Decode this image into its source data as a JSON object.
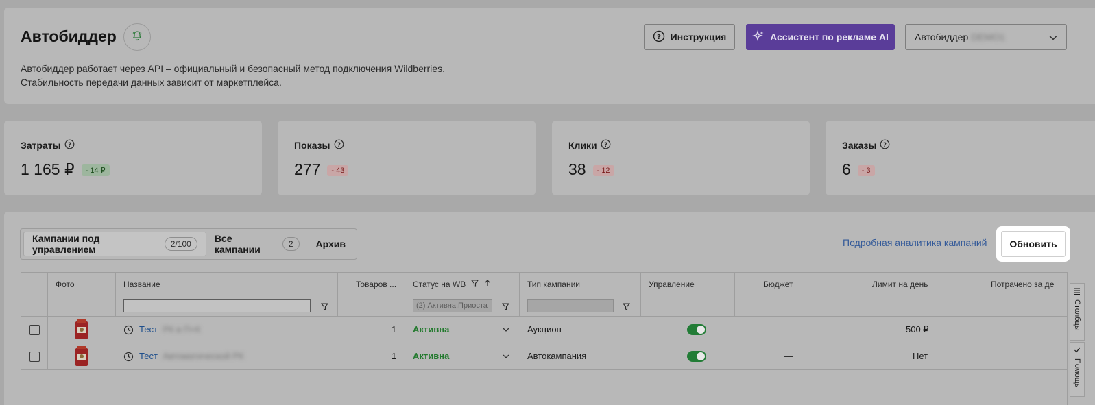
{
  "header": {
    "title": "Автобиддер",
    "description_line1": "Автобиддер работает через API – официальный и безопасный метод подключения Wildberries.",
    "description_line2": "Стабильность передачи данных зависит от маркетплейса.",
    "instruction_label": "Инструкция",
    "ai_assistant_label": "Ассистент по рекламе AI",
    "bidder_select_label": "Автобиддер",
    "bidder_select_value": "DEMO1"
  },
  "metrics": [
    {
      "label": "Затраты",
      "value": "1 165 ₽",
      "delta": "- 14 ₽",
      "delta_type": "green"
    },
    {
      "label": "Показы",
      "value": "277",
      "delta": "- 43",
      "delta_type": "red"
    },
    {
      "label": "Клики",
      "value": "38",
      "delta": "- 12",
      "delta_type": "red"
    },
    {
      "label": "Заказы",
      "value": "6",
      "delta": "- 3",
      "delta_type": "red"
    }
  ],
  "tabs": [
    {
      "label": "Кампании под управлением",
      "count": "2/100"
    },
    {
      "label": "Все кампании",
      "count": "2"
    },
    {
      "label": "Архив"
    }
  ],
  "analytics_link": "Подробная аналитика кампаний",
  "refresh_label": "Обновить",
  "table": {
    "headers": {
      "photo": "Фото",
      "name": "Название",
      "goods": "Товаров ...",
      "status": "Статус на WB",
      "type": "Тип кампании",
      "control": "Управление",
      "budget": "Бюджет",
      "limit": "Лимит на день",
      "spent": "Потрачено за де"
    },
    "status_filter_value": "(2) Активна,Приоста",
    "rows": [
      {
        "name": "Тест",
        "name_hidden": "РК в П+К",
        "goods": "1",
        "status": "Активна",
        "type": "Аукцион",
        "budget": "—",
        "limit": "500 ₽"
      },
      {
        "name": "Тест",
        "name_hidden": "Автоматической РК",
        "goods": "1",
        "status": "Активна",
        "type": "Автокампания",
        "budget": "—",
        "limit": "Нет"
      }
    ],
    "side_tabs": {
      "columns": "Столбцы",
      "help": "Помощь"
    }
  }
}
